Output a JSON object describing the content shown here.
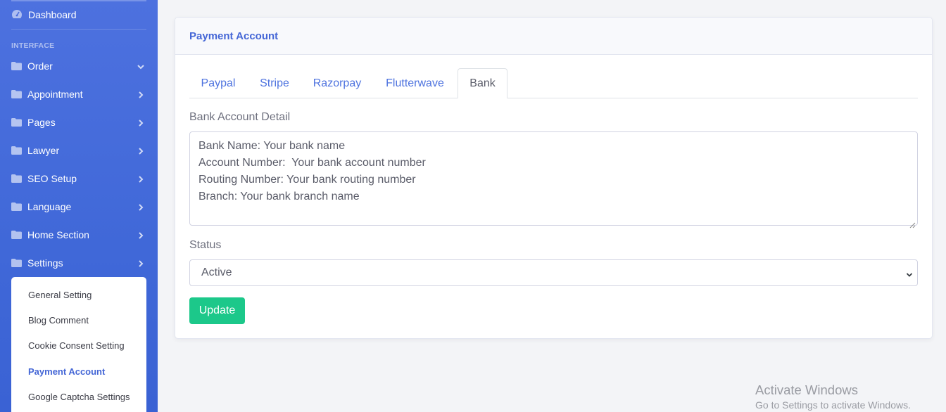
{
  "sidebar": {
    "dashboard_label": "Dashboard",
    "section_heading": "INTERFACE",
    "items": [
      {
        "label": "Order",
        "chevron": "chevron-down"
      },
      {
        "label": "Appointment",
        "chevron": "chevron-right"
      },
      {
        "label": "Pages",
        "chevron": "chevron-right"
      },
      {
        "label": "Lawyer",
        "chevron": "chevron-right"
      },
      {
        "label": "SEO Setup",
        "chevron": "chevron-right"
      },
      {
        "label": "Language",
        "chevron": "chevron-right"
      },
      {
        "label": "Home Section",
        "chevron": "chevron-right"
      },
      {
        "label": "Settings",
        "chevron": "chevron-right"
      }
    ],
    "settings_submenu": [
      {
        "label": "General Setting"
      },
      {
        "label": "Blog Comment"
      },
      {
        "label": "Cookie Consent Setting"
      },
      {
        "label": "Payment Account",
        "active": true
      },
      {
        "label": "Google Captcha Settings"
      }
    ],
    "bg_color": "#4e73df"
  },
  "card": {
    "title": "Payment Account",
    "tabs": [
      {
        "label": "Paypal"
      },
      {
        "label": "Stripe"
      },
      {
        "label": "Razorpay"
      },
      {
        "label": "Flutterwave"
      },
      {
        "label": "Bank",
        "active": true
      }
    ],
    "bank_detail_label": "Bank Account Detail",
    "bank_detail_lines": [
      "Bank Name: Your bank name",
      "Account Number:  Your bank account number",
      "Routing Number: Your bank routing number",
      "Branch: Your bank branch name"
    ],
    "status_label": "Status",
    "status_value": "Active",
    "update_button": "Update"
  },
  "watermark": {
    "line1": "Activate Windows",
    "line2": "Go to Settings to activate Windows."
  },
  "colors": {
    "accent": "#4e73df",
    "success": "#1cc88a"
  }
}
